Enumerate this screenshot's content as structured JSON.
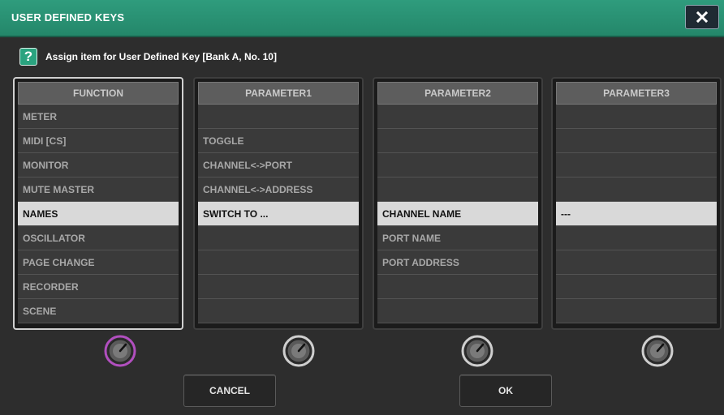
{
  "window": {
    "title": "USER DEFINED KEYS"
  },
  "help": {
    "icon": "?",
    "text": "Assign item for User Defined Key [Bank A, No. 10]"
  },
  "columns": [
    {
      "header": "FUNCTION",
      "rows": [
        "METER",
        "MIDI [CS]",
        "MONITOR",
        "MUTE MASTER",
        "NAMES",
        "OSCILLATOR",
        "PAGE CHANGE",
        "RECORDER",
        "SCENE"
      ],
      "selected": 4,
      "active": true
    },
    {
      "header": "PARAMETER1",
      "rows": [
        "",
        "TOGGLE",
        "CHANNEL<->PORT",
        "CHANNEL<->ADDRESS",
        "SWITCH TO ...",
        "",
        "",
        "",
        ""
      ],
      "selected": 4,
      "active": false
    },
    {
      "header": "PARAMETER2",
      "rows": [
        "",
        "",
        "",
        "",
        "CHANNEL NAME",
        "PORT NAME",
        "PORT ADDRESS",
        "",
        ""
      ],
      "selected": 4,
      "active": false
    },
    {
      "header": "PARAMETER3",
      "rows": [
        "",
        "",
        "",
        "",
        "---",
        "",
        "",
        "",
        ""
      ],
      "selected": 4,
      "active": false
    }
  ],
  "buttons": {
    "cancel": "CANCEL",
    "ok": "OK"
  },
  "colors": {
    "accent": "#2a9b7b",
    "knob_active": "#b14fbf",
    "selected_row": "#d9d9d9"
  },
  "icons": {
    "close": "close-icon",
    "help": "question-icon",
    "knob": "rotary-knob-icon"
  }
}
